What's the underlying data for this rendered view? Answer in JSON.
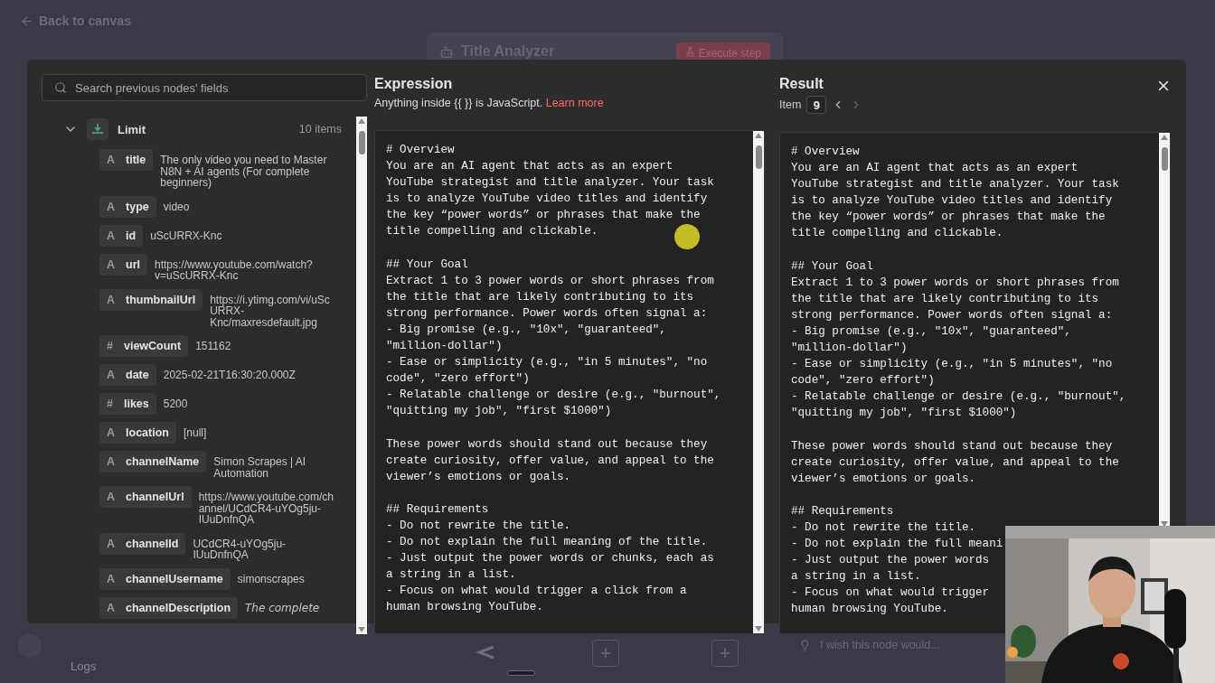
{
  "background": {
    "back_link": "Back to canvas",
    "node_title": "Title Analyzer",
    "execute_button": "Execute step",
    "wish_placeholder": "I wish this node would...",
    "logs_label": "Logs"
  },
  "search": {
    "placeholder": "Search previous nodes' fields"
  },
  "tree": {
    "node": "Limit",
    "count": "10 items",
    "expanded": true,
    "fields": [
      {
        "glyph": "A",
        "key": "title",
        "value": "The only video you need to Master N8N + AI agents (For complete beginners)",
        "italic": false
      },
      {
        "glyph": "A",
        "key": "type",
        "value": "video",
        "italic": false
      },
      {
        "glyph": "A",
        "key": "id",
        "value": "uScURRX-Knc",
        "italic": false
      },
      {
        "glyph": "A",
        "key": "url",
        "value": "https://www.youtube.com/watch?v=uScURRX-Knc",
        "italic": false
      },
      {
        "glyph": "A",
        "key": "thumbnailUrl",
        "value": "https://i.ytimg.com/vi/uScURRX-Knc/maxresdefault.jpg",
        "italic": false
      },
      {
        "glyph": "#",
        "key": "viewCount",
        "value": "151162",
        "italic": false
      },
      {
        "glyph": "A",
        "key": "date",
        "value": "2025-02-21T16:30:20.000Z",
        "italic": false
      },
      {
        "glyph": "#",
        "key": "likes",
        "value": "5200",
        "italic": false
      },
      {
        "glyph": "A",
        "key": "location",
        "value": "[null]",
        "italic": false
      },
      {
        "glyph": "A",
        "key": "channelName",
        "value": "Simon Scrapes | AI Automation",
        "italic": false
      },
      {
        "glyph": "A",
        "key": "channelUrl",
        "value": "https://www.youtube.com/channel/UCdCR4-uYOg5ju-IUuDnfnQA",
        "italic": false
      },
      {
        "glyph": "A",
        "key": "channelId",
        "value": "UCdCR4-uYOg5ju-IUuDnfnQA",
        "italic": false
      },
      {
        "glyph": "A",
        "key": "channelUsername",
        "value": "simonscrapes",
        "italic": false
      },
      {
        "glyph": "A",
        "key": "channelDescription",
        "value": "The complete",
        "italic": true
      }
    ]
  },
  "expression": {
    "title": "Expression",
    "hint": "Anything inside {{ }} is JavaScript.",
    "link": "Learn more",
    "blocks": [
      [
        "# Overview",
        "You are an AI agent that acts as an expert",
        "YouTube strategist and title analyzer. Your task",
        "is to analyze YouTube video titles and identify",
        "the key “power words” or phrases that make the",
        "title compelling and clickable."
      ],
      [
        "## Your Goal",
        "Extract 1 to 3 power words or short phrases from",
        "the title that are likely contributing to its",
        "strong performance. Power words often signal a:",
        "- Big promise (e.g., \"10x\", \"guaranteed\",",
        "\"million-dollar\")",
        "- Ease or simplicity (e.g., \"in 5 minutes\", \"no",
        "code\", \"zero effort\")",
        "- Relatable challenge or desire (e.g., \"burnout\",",
        "\"quitting my job\", \"first $1000\")"
      ],
      [
        "These power words should stand out because they",
        "create curiosity, offer value, and appeal to the",
        "viewer’s emotions or goals."
      ],
      [
        "## Requirements",
        "- Do not rewrite the title.",
        "- Do not explain the full meaning of the title.",
        "- Just output the power words or chunks, each as",
        "a string in a list.",
        "- Focus on what would trigger a click from a",
        "human browsing YouTube."
      ]
    ]
  },
  "result": {
    "title": "Result",
    "item_label": "Item",
    "item_number": "9",
    "blocks": [
      [
        "# Overview",
        "You are an AI agent that acts as an expert",
        "YouTube strategist and title analyzer. Your task",
        "is to analyze YouTube video titles and identify",
        "the key “power words” or phrases that make the",
        "title compelling and clickable."
      ],
      [
        "## Your Goal",
        "Extract 1 to 3 power words or short phrases from",
        "the title that are likely contributing to its",
        "strong performance. Power words often signal a:",
        "- Big promise (e.g., \"10x\", \"guaranteed\",",
        "\"million-dollar\")",
        "- Ease or simplicity (e.g., \"in 5 minutes\", \"no",
        "code\", \"zero effort\")",
        "- Relatable challenge or desire (e.g., \"burnout\",",
        "\"quitting my job\", \"first $1000\")"
      ],
      [
        "These power words should stand out because they",
        "create curiosity, offer value, and appeal to the",
        "viewer’s emotions or goals."
      ],
      [
        "## Requirements",
        "- Do not rewrite the title.",
        "- Do not explain the full meani",
        "- Just output the power words",
        "a string in a list.",
        "- Focus on what would trigger",
        "human browsing YouTube."
      ]
    ]
  }
}
